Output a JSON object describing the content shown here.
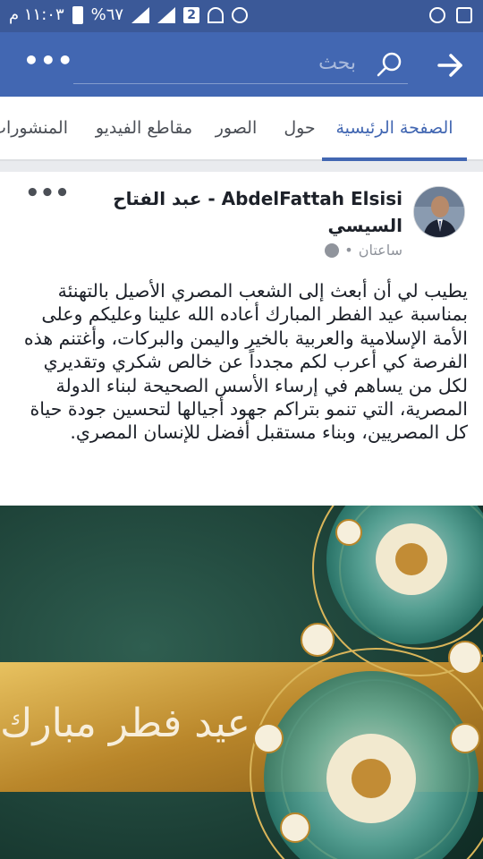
{
  "status_bar": {
    "time": "١١:٠٣ م",
    "battery": "%٦٧",
    "sim_badge": "2"
  },
  "header": {
    "search_placeholder": "بحث"
  },
  "tabs": [
    {
      "label": "الصفحة الرئيسية",
      "active": true
    },
    {
      "label": "حول",
      "active": false
    },
    {
      "label": "الصور",
      "active": false
    },
    {
      "label": "مقاطع الفيديو",
      "active": false
    },
    {
      "label": "المنشورات",
      "active": false
    }
  ],
  "post": {
    "author": "AbdelFattah Elsisi - عبد الفتاح السيسي",
    "time": "ساعتان",
    "separator": "•",
    "text": "يطيب لي أن أبعث إلى الشعب المصري الأصيل بالتهنئة بمناسبة عيد الفطر المبارك أعاده الله علينا وعليكم وعلى الأمة الإسلامية والعربية بالخير واليمن والبركات، وأغتنم هذه الفرصة كي أعرب لكم مجدداً عن خالص شكري وتقديري لكل من يساهم في إرساء الأسس الصحيحة لبناء الدولة المصرية، التي تنمو بتراكم جهود أجيالها لتحسين جودة حياة كل المصريين، وبناء مستقبل أفضل للإنسان المصري.",
    "image_text": "عيد فطر مبارك"
  },
  "colors": {
    "brand": "#4267b2",
    "statusbar": "#3b5998",
    "image_gold": "#c9982e",
    "image_teal": "#1f4a3f"
  }
}
